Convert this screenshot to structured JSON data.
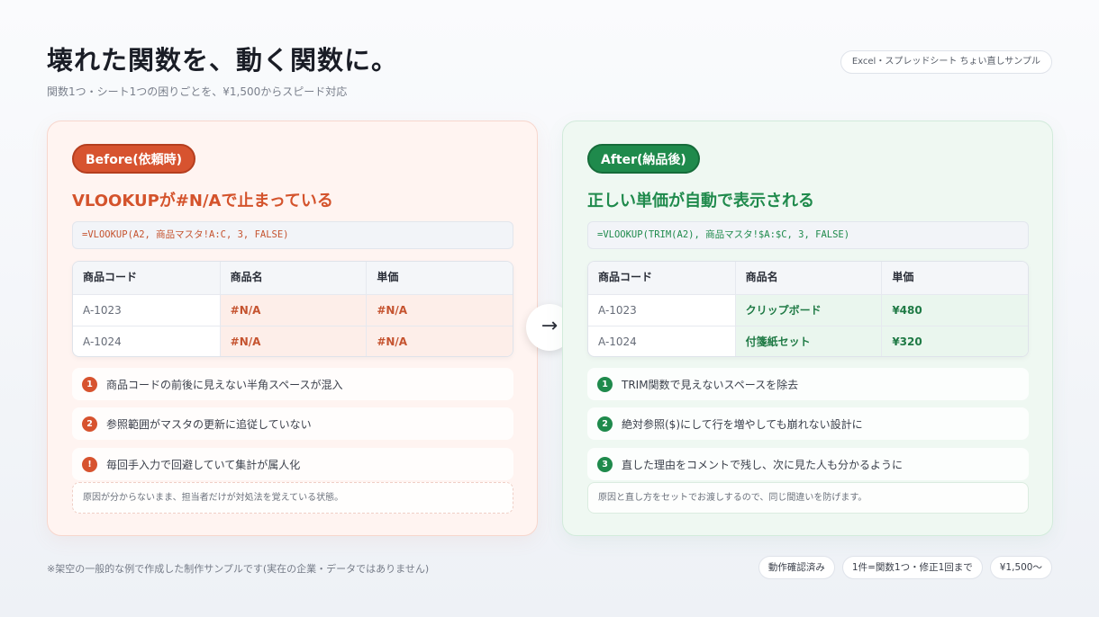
{
  "header": {
    "title": "壊れた関数を、動く関数に。",
    "subtitle": "関数1つ・シート1つの困りごとを、¥1,500からスピード対応",
    "tag": "Excel・スプレッドシート ちょい直しサンプル"
  },
  "before": {
    "badge": "Before(依頼時)",
    "heading": "VLOOKUPが#N/Aで止まっている",
    "formula": "=VLOOKUP(A2, 商品マスタ!A:C, 3, FALSE)",
    "table": {
      "headers": [
        "商品コード",
        "商品名",
        "単価"
      ],
      "rows": [
        [
          "A-1023",
          "#N/A",
          "#N/A"
        ],
        [
          "A-1024",
          "#N/A",
          "#N/A"
        ]
      ]
    },
    "items": [
      {
        "marker": "1",
        "text": "商品コードの前後に見えない半角スペースが混入"
      },
      {
        "marker": "2",
        "text": "参照範囲がマスタの更新に追従していない"
      },
      {
        "marker": "!",
        "text": "毎回手入力で回避していて集計が属人化"
      }
    ],
    "note": "原因が分からないまま、担当者だけが対処法を覚えている状態。"
  },
  "after": {
    "badge": "After(納品後)",
    "heading": "正しい単価が自動で表示される",
    "formula": "=VLOOKUP(TRIM(A2), 商品マスタ!$A:$C, 3, FALSE)",
    "table": {
      "headers": [
        "商品コード",
        "商品名",
        "単価"
      ],
      "rows": [
        [
          "A-1023",
          "クリップボード",
          "¥480"
        ],
        [
          "A-1024",
          "付箋紙セット",
          "¥320"
        ]
      ]
    },
    "items": [
      {
        "marker": "1",
        "text": "TRIM関数で見えないスペースを除去"
      },
      {
        "marker": "2",
        "text": "絶対参照($)にして行を増やしても崩れない設計に"
      },
      {
        "marker": "3",
        "text": "直した理由をコメントで残し、次に見た人も分かるように"
      }
    ],
    "note": "原因と直し方をセットでお渡しするので、同じ間違いを防げます。"
  },
  "arrow": "→",
  "footer": {
    "note": "※架空の一般的な例で作成した制作サンプルです(実在の企業・データではありません)",
    "chips": [
      "動作確認済み",
      "1件=関数1つ・修正1回まで",
      "¥1,500〜"
    ]
  },
  "colors": {
    "before_accent": "#d7532f",
    "after_accent": "#1f8a4c"
  }
}
